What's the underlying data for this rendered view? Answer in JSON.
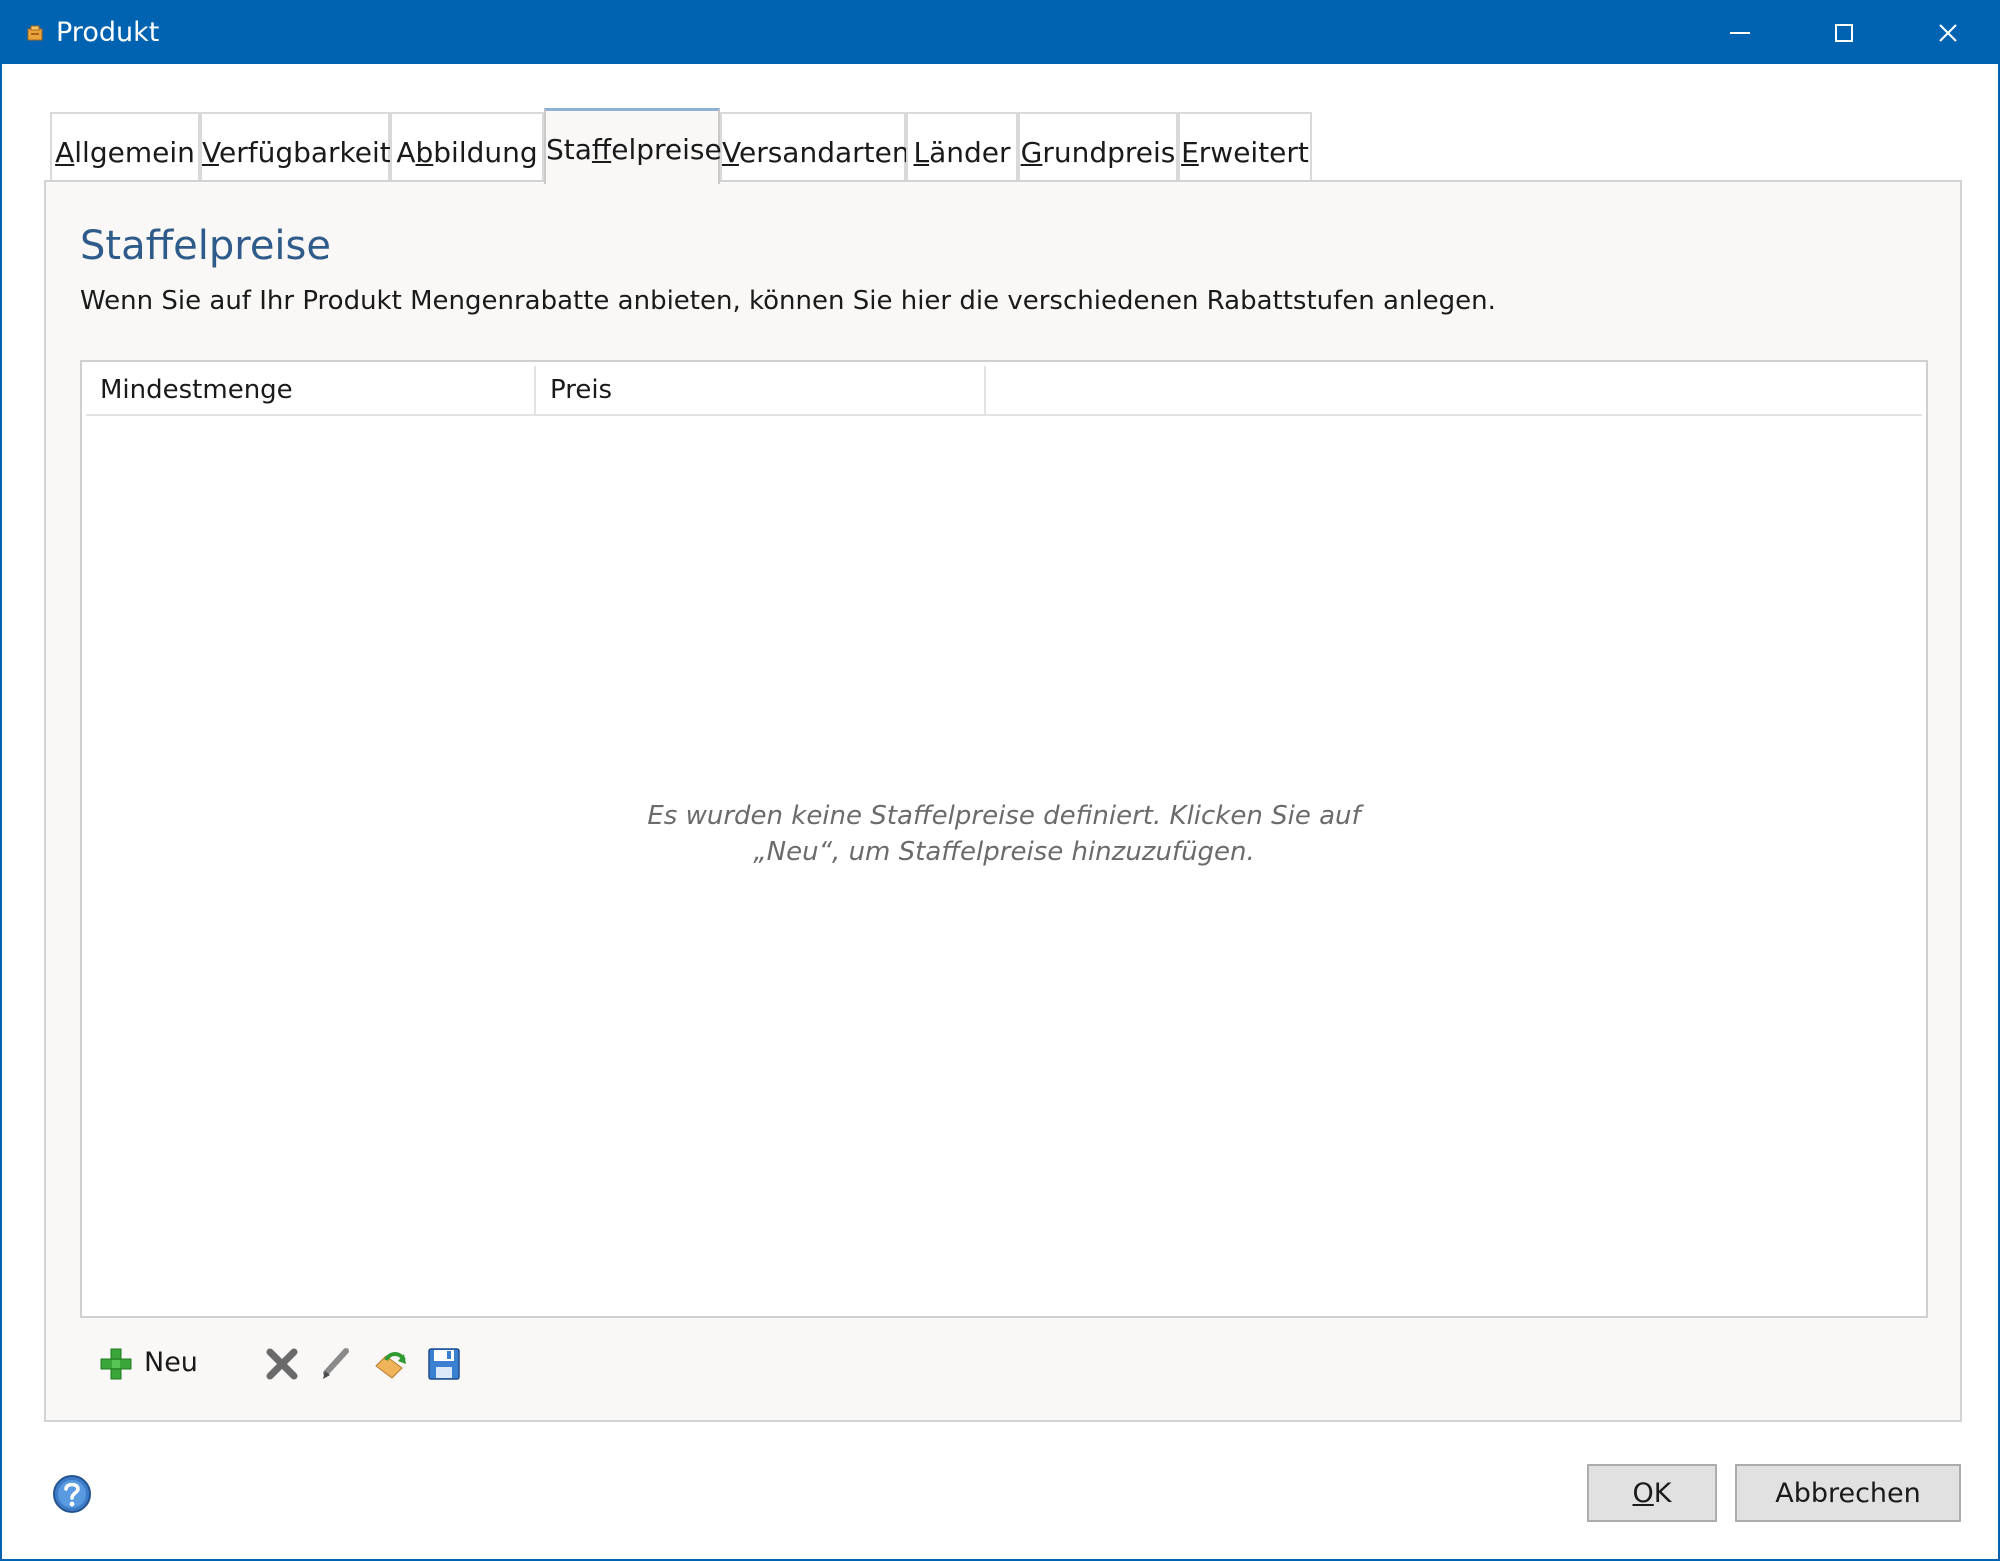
{
  "window": {
    "title": "Produkt",
    "accent_color": "#0063b1",
    "controls": [
      "minimize-icon",
      "maximize-icon",
      "close-icon"
    ]
  },
  "tabs": [
    {
      "pre": "",
      "key": "A",
      "post": "llgemein",
      "active": false
    },
    {
      "pre": "",
      "key": "V",
      "post": "erfügbarkeit",
      "active": false
    },
    {
      "pre": "A",
      "key": "b",
      "post": "bildung",
      "active": false
    },
    {
      "pre": "Sta",
      "key": "f",
      "post": "felpreise",
      "active": true
    },
    {
      "pre": "",
      "key": "V",
      "post": "ersandarten",
      "active": false
    },
    {
      "pre": "",
      "key": "L",
      "post": "änder",
      "active": false
    },
    {
      "pre": "",
      "key": "G",
      "post": "rundpreis",
      "active": false
    },
    {
      "pre": "",
      "key": "E",
      "post": "rweitert",
      "active": false
    }
  ],
  "section": {
    "title": "Staffelpreise",
    "description": "Wenn Sie auf Ihr Produkt Mengenrabatte anbieten, können Sie hier die verschiedenen Rabattstufen anlegen."
  },
  "table": {
    "columns": [
      "Mindestmenge",
      "Preis",
      ""
    ],
    "rows": [],
    "empty_line1": "Es wurden keine Staffelpreise definiert. Klicken Sie auf",
    "empty_line2": "„Neu“, um Staffelpreise hinzuzufügen."
  },
  "toolbar": {
    "new_label": "Neu",
    "icons": [
      "add-icon",
      "delete-icon",
      "edit-icon",
      "undo-icon",
      "save-icon"
    ]
  },
  "footer": {
    "ok_key": "O",
    "ok_rest": "K",
    "cancel_label": "Abbrechen"
  }
}
